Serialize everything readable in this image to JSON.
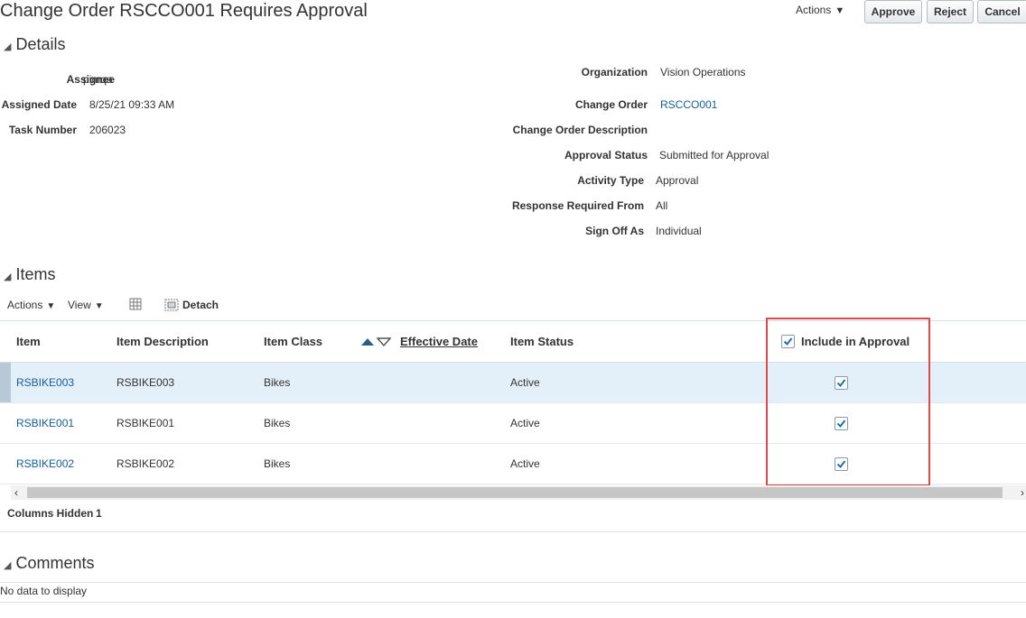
{
  "header": {
    "title": "Change Order RSCCO001 Requires Approval",
    "actions_label": "Actions",
    "approve_label": "Approve",
    "reject_label": "Reject",
    "cancel_label": "Cancel"
  },
  "details": {
    "section_title": "Details",
    "left": [
      {
        "label": "Assignee",
        "value": "pimqa"
      },
      {
        "label": "Assigned Date",
        "value": "8/25/21 09:33 AM"
      },
      {
        "label": "Task Number",
        "value": "206023"
      }
    ],
    "right": [
      {
        "label": "Organization",
        "value": "Vision Operations"
      },
      {
        "label": "Change Order",
        "value": "RSCCO001"
      },
      {
        "label": "Change Order Description",
        "value": ""
      },
      {
        "label": "Approval Status",
        "value": "Submitted for Approval"
      },
      {
        "label": "Activity Type",
        "value": "Approval"
      },
      {
        "label": "Response Required From",
        "value": "All"
      },
      {
        "label": "Sign Off As",
        "value": "Individual"
      }
    ]
  },
  "items": {
    "section_title": "Items",
    "toolbar": {
      "actions_label": "Actions",
      "view_label": "View",
      "detach_label": "Detach"
    },
    "columns": {
      "item": "Item",
      "item_description": "Item Description",
      "item_class": "Item Class",
      "effective_date": "Effective Date",
      "item_status": "Item Status",
      "include_in_approval": "Include in Approval"
    },
    "rows": [
      {
        "item": "RSBIKE003",
        "description": "RSBIKE003",
        "item_class": "Bikes",
        "status": "Active",
        "include": true
      },
      {
        "item": "RSBIKE001",
        "description": "RSBIKE001",
        "item_class": "Bikes",
        "status": "Active",
        "include": true
      },
      {
        "item": "RSBIKE002",
        "description": "RSBIKE002",
        "item_class": "Bikes",
        "status": "Active",
        "include": true
      }
    ],
    "columns_hidden_label": "Columns Hidden",
    "columns_hidden_value": "1"
  },
  "comments": {
    "section_title": "Comments",
    "empty_text": "No data to display"
  },
  "colors": {
    "link": "#145c9e",
    "checkbox_check": "#1f6fb5",
    "highlight_box": "#e04a4a",
    "selected_row": "#e4f0f9"
  }
}
